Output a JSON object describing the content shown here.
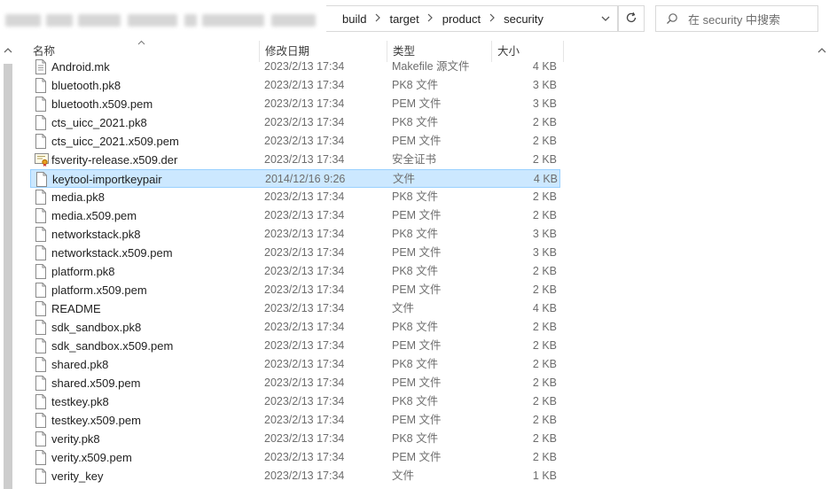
{
  "address": {
    "crumbs": [
      "build",
      "target",
      "product",
      "security"
    ]
  },
  "search": {
    "placeholder": "在 security 中搜索"
  },
  "columns": {
    "name": "名称",
    "date": "修改日期",
    "type": "类型",
    "size": "大小"
  },
  "files": [
    {
      "name": "Android.mk",
      "date": "2023/2/13 17:34",
      "type": "Makefile 源文件",
      "size": "4 KB",
      "icon": "makefile-file-icon"
    },
    {
      "name": "bluetooth.pk8",
      "date": "2023/2/13 17:34",
      "type": "PK8 文件",
      "size": "3 KB",
      "icon": "file-icon"
    },
    {
      "name": "bluetooth.x509.pem",
      "date": "2023/2/13 17:34",
      "type": "PEM 文件",
      "size": "3 KB",
      "icon": "file-icon"
    },
    {
      "name": "cts_uicc_2021.pk8",
      "date": "2023/2/13 17:34",
      "type": "PK8 文件",
      "size": "2 KB",
      "icon": "file-icon"
    },
    {
      "name": "cts_uicc_2021.x509.pem",
      "date": "2023/2/13 17:34",
      "type": "PEM 文件",
      "size": "2 KB",
      "icon": "file-icon"
    },
    {
      "name": "fsverity-release.x509.der",
      "date": "2023/2/13 17:34",
      "type": "安全证书",
      "size": "2 KB",
      "icon": "certificate-icon"
    },
    {
      "name": "keytool-importkeypair",
      "date": "2014/12/16 9:26",
      "type": "文件",
      "size": "4 KB",
      "icon": "file-icon",
      "selected": true
    },
    {
      "name": "media.pk8",
      "date": "2023/2/13 17:34",
      "type": "PK8 文件",
      "size": "2 KB",
      "icon": "file-icon"
    },
    {
      "name": "media.x509.pem",
      "date": "2023/2/13 17:34",
      "type": "PEM 文件",
      "size": "2 KB",
      "icon": "file-icon"
    },
    {
      "name": "networkstack.pk8",
      "date": "2023/2/13 17:34",
      "type": "PK8 文件",
      "size": "3 KB",
      "icon": "file-icon"
    },
    {
      "name": "networkstack.x509.pem",
      "date": "2023/2/13 17:34",
      "type": "PEM 文件",
      "size": "3 KB",
      "icon": "file-icon"
    },
    {
      "name": "platform.pk8",
      "date": "2023/2/13 17:34",
      "type": "PK8 文件",
      "size": "2 KB",
      "icon": "file-icon"
    },
    {
      "name": "platform.x509.pem",
      "date": "2023/2/13 17:34",
      "type": "PEM 文件",
      "size": "2 KB",
      "icon": "file-icon"
    },
    {
      "name": "README",
      "date": "2023/2/13 17:34",
      "type": "文件",
      "size": "4 KB",
      "icon": "file-icon"
    },
    {
      "name": "sdk_sandbox.pk8",
      "date": "2023/2/13 17:34",
      "type": "PK8 文件",
      "size": "2 KB",
      "icon": "file-icon"
    },
    {
      "name": "sdk_sandbox.x509.pem",
      "date": "2023/2/13 17:34",
      "type": "PEM 文件",
      "size": "2 KB",
      "icon": "file-icon"
    },
    {
      "name": "shared.pk8",
      "date": "2023/2/13 17:34",
      "type": "PK8 文件",
      "size": "2 KB",
      "icon": "file-icon"
    },
    {
      "name": "shared.x509.pem",
      "date": "2023/2/13 17:34",
      "type": "PEM 文件",
      "size": "2 KB",
      "icon": "file-icon"
    },
    {
      "name": "testkey.pk8",
      "date": "2023/2/13 17:34",
      "type": "PK8 文件",
      "size": "2 KB",
      "icon": "file-icon"
    },
    {
      "name": "testkey.x509.pem",
      "date": "2023/2/13 17:34",
      "type": "PEM 文件",
      "size": "2 KB",
      "icon": "file-icon"
    },
    {
      "name": "verity.pk8",
      "date": "2023/2/13 17:34",
      "type": "PK8 文件",
      "size": "2 KB",
      "icon": "file-icon"
    },
    {
      "name": "verity.x509.pem",
      "date": "2023/2/13 17:34",
      "type": "PEM 文件",
      "size": "2 KB",
      "icon": "file-icon"
    },
    {
      "name": "verity_key",
      "date": "2023/2/13 17:34",
      "type": "文件",
      "size": "1 KB",
      "icon": "file-icon"
    }
  ],
  "colors": {
    "selection_bg": "#cce8ff",
    "selection_border": "#99d1ff",
    "secondary_text": "#6d6d6d"
  }
}
